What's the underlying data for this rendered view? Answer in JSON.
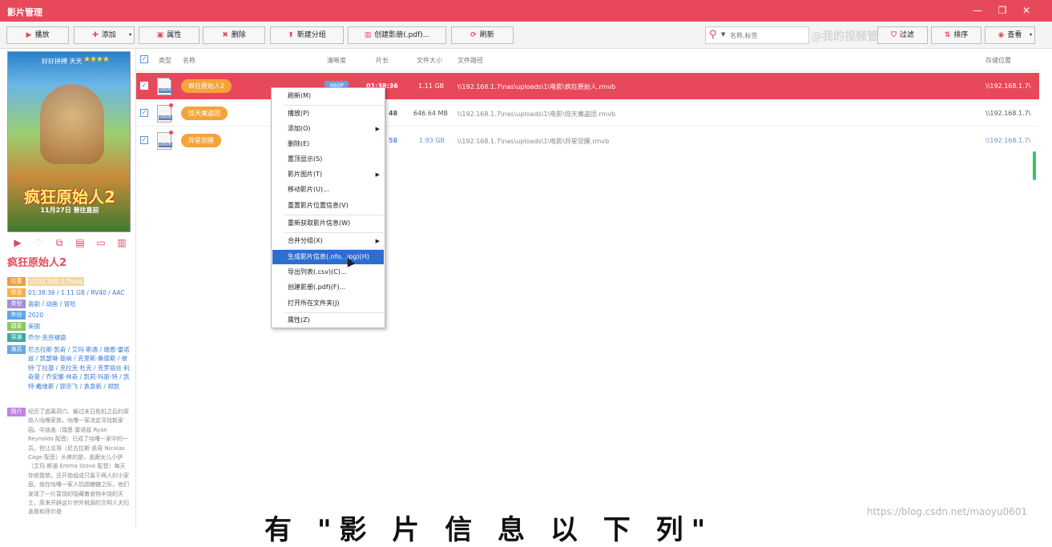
{
  "app": {
    "title": "影片管理"
  },
  "window": {
    "min": "—",
    "restore": "❐",
    "close": "✕"
  },
  "toolbar": {
    "play": "播放",
    "add": "添加",
    "props": "属性",
    "delete": "删除",
    "new_group": "新建分组",
    "create_pdf": "创建影册(.pdf)...",
    "refresh": "刷新",
    "filter": "过滤",
    "sort": "排序",
    "view": "查看"
  },
  "search": {
    "placeholder": "名称,标签"
  },
  "watermark_top": "@我的视频管家",
  "sidebar": {
    "poster": {
      "tagline": "好好拼搏 天天",
      "stars": "★★★★",
      "title": "疯狂原始人2",
      "date": "11月27日 普往直前"
    },
    "title": "疯狂原始人2",
    "info": [
      {
        "label": "位置",
        "value": "\\\\192.168.1.7\\nas",
        "color": "#e8a23c"
      },
      {
        "label": "信息",
        "value": "01:38:36 / 1.11 GB / RV40 / AAC",
        "color": "#f5b04a"
      },
      {
        "label": "类型",
        "value": "喜剧 / 动画 / 冒险",
        "color": "#a58fd6"
      },
      {
        "label": "年份",
        "value": "2020",
        "color": "#5ea7e8"
      },
      {
        "label": "国家",
        "value": "美国",
        "color": "#8ac85f"
      },
      {
        "label": "导演",
        "value": "乔尔·克劳福德",
        "color": "#41a8a3"
      },
      {
        "label": "演员",
        "value": "尼古拉斯·凯奇 / 艾玛·斯通 / 瑞恩·雷诺兹 / 凯瑟琳·基纳 / 克里斯·桑德斯 / 彼特·丁拉基 / 克拉克·杜克 / 克罗丽丝·利奇曼 / 乔安娜·林奇 / 凯莉·玛丽·特 / 凯特·戴维斯 / 郭京飞 / 袁泉新 / 郑凯",
        "color": "#6aa7e0"
      }
    ],
    "intro": {
      "label": "简介",
      "value": "经历了逃离洞穴、躲过末日危机之后的原始人咕噜家族，咕噜一家决定寻找新家园。中途盖（瑞恩·雷诺兹 Ryan Reynolds 配音）已成了咕噜一家中的一员。但让瓜哥（尼古拉斯·凯奇 Nicolas Cage 配音）头疼的是，盖跟女儿小伊（艾玛·斯通 Emma Stone 配音）每天你侬我侬，还开始组成只属于两人的小家庭。就在咕噜一家人饥肠辘辘之际，他们发现了一片富饶的隐藏着食物丰饶的天土，原来开辟这片世外桃源的文明人夫妇盖普和菲尔普"
    }
  },
  "table": {
    "headers": {
      "type": "类型",
      "name": "名称",
      "definition": "清晰度",
      "duration": "片长",
      "size": "文件大小",
      "path": "文件路径",
      "location": "存储位置"
    },
    "rows": [
      {
        "name": "疯狂原始人2",
        "definition": "480P",
        "duration": "01:38:36",
        "size": "1.11 GB",
        "path": "\\\\192.168.1.7\\nas\\uploads\\1\\电影\\疯狂原始人.rmvb",
        "location": "\\\\192.168.1.7\\",
        "ftype": "RMVB"
      },
      {
        "name": "惊天魔盗团",
        "duration": "48",
        "size": "646.64 MB",
        "path": "\\\\192.168.1.7\\nas\\uploads\\1\\电影\\惊天魔盗团.rmvb",
        "location": "\\\\192.168.1.7\\",
        "ftype": "RMVB"
      },
      {
        "name": "异星觉醒",
        "duration": "58",
        "size": "1.93 GB",
        "path": "\\\\192.168.1.7\\nas\\uploads\\1\\电影\\异星觉醒.rmvb",
        "location": "\\\\192.168.1.7\\",
        "ftype": "RMVB"
      }
    ]
  },
  "context_menu": {
    "items": [
      "刷新(M)",
      "播放(P)",
      "添加(O)",
      "删除(E)",
      "置顶显示(S)",
      "影片图片(T)",
      "移动影片(U)...",
      "重置影片位置信息(V)",
      "重新获取影片信息(W)",
      "合并分组(X)",
      "生成影片信息(.nfo, .jpg)(H)",
      "导出列表(.csv)(C)...",
      "创建影册(.pdf)(F)...",
      "打开所在文件夹(J)",
      "属性(Z)"
    ],
    "highlight": "生成影片信息(.nfo, .jpg)(H)"
  },
  "footer": {
    "big_text": "有 \"影 片 信 息 以 下 列\"",
    "watermark": "https://blog.csdn.net/maoyu0601"
  }
}
